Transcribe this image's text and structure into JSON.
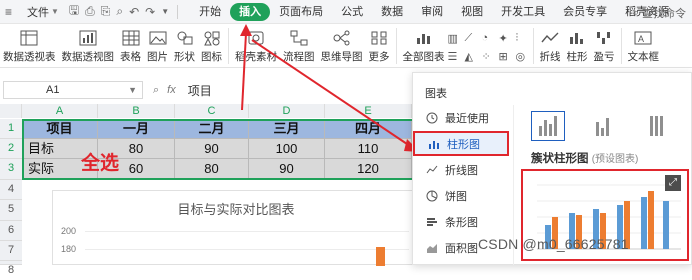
{
  "menubar": {
    "file_label": "文件",
    "tabs": [
      {
        "label": "开始",
        "active": false
      },
      {
        "label": "插入",
        "active": true
      },
      {
        "label": "页面布局",
        "active": false
      },
      {
        "label": "公式",
        "active": false
      },
      {
        "label": "数据",
        "active": false
      },
      {
        "label": "审阅",
        "active": false
      },
      {
        "label": "视图",
        "active": false
      },
      {
        "label": "开发工具",
        "active": false
      },
      {
        "label": "会员专享",
        "active": false
      },
      {
        "label": "稻壳资源",
        "active": false
      }
    ],
    "search_label": "查找命令"
  },
  "ribbon": {
    "pivot_table": "数据透视表",
    "pivot_chart": "数据透视图",
    "table": "表格",
    "picture": "图片",
    "shapes": "形状",
    "icons": "图标",
    "docer_material": "稻壳素材",
    "flowchart": "流程图",
    "mindmap": "思维导图",
    "more": "更多",
    "all_charts": "全部图表",
    "sparkline_line": "折线",
    "sparkline_column": "柱形",
    "sparkline_winloss": "盈亏",
    "textbox": "文本框"
  },
  "formula_bar": {
    "cell_ref": "A1",
    "fx_label": "fx",
    "content": "项目"
  },
  "sheet": {
    "columns": [
      "A",
      "B",
      "C",
      "D",
      "E"
    ],
    "rows": [
      "1",
      "2",
      "3",
      "4",
      "5",
      "6",
      "7",
      "8"
    ],
    "header_row": [
      "项目",
      "一月",
      "二月",
      "三月",
      "四月"
    ],
    "data_rows": [
      [
        "目标",
        "80",
        "90",
        "100",
        "110"
      ],
      [
        "实际",
        "60",
        "80",
        "90",
        "120"
      ]
    ],
    "annotation": "全选"
  },
  "embedded_chart": {
    "title": "目标与实际对比图表",
    "ticks": [
      "200",
      "180"
    ]
  },
  "chart_panel": {
    "title": "图表",
    "categories": [
      {
        "label": "最近使用",
        "active": false,
        "icon": "clock-icon"
      },
      {
        "label": "柱形图",
        "active": true,
        "icon": "bar-chart-icon"
      },
      {
        "label": "折线图",
        "active": false,
        "icon": "line-chart-icon"
      },
      {
        "label": "饼图",
        "active": false,
        "icon": "pie-chart-icon"
      },
      {
        "label": "条形图",
        "active": false,
        "icon": "hbar-chart-icon"
      },
      {
        "label": "面积图",
        "active": false,
        "icon": "area-chart-icon"
      }
    ],
    "subtype_title": "簇状柱形图",
    "subtype_note": "(预设图表)"
  },
  "colors": {
    "accent_green": "#1fa15a",
    "annotation_red": "#e0262d",
    "header_fill": "#9db7df",
    "data_fill": "#d9d9d9",
    "series_blue": "#5b9bd5",
    "series_orange": "#ed7d31"
  },
  "watermark": "CSDN @m0_66625781"
}
